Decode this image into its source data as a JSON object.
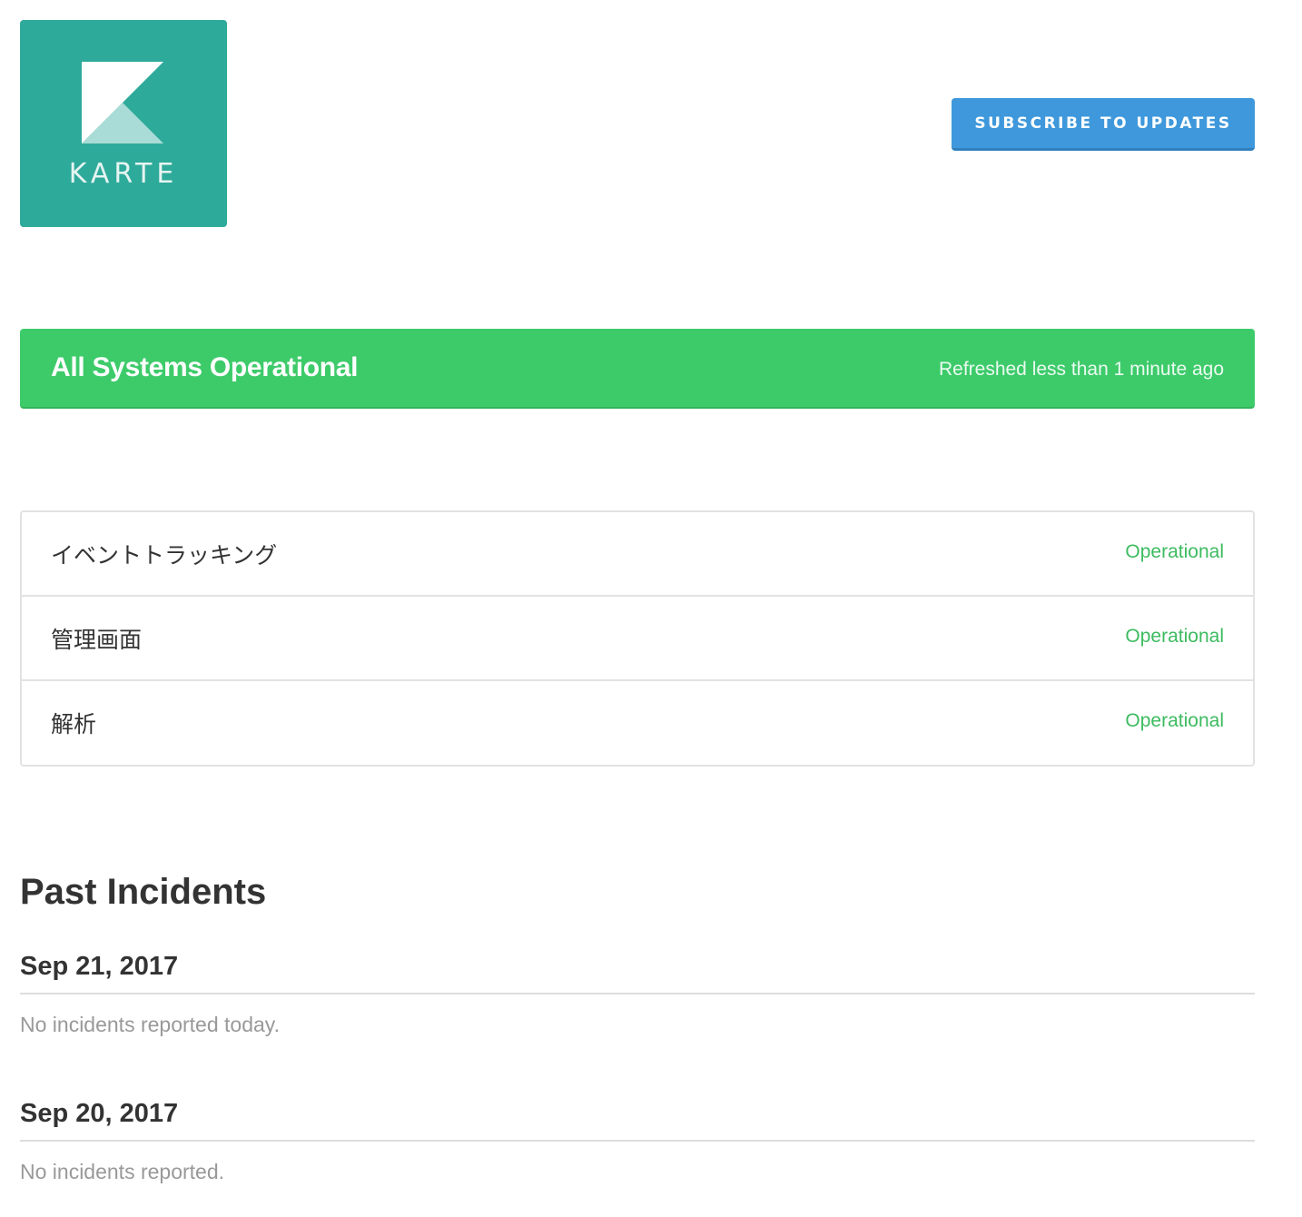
{
  "header": {
    "logo_text": "KARTE",
    "subscribe_label": "Subscribe to Updates"
  },
  "colors": {
    "logo_bg": "#2eaa9b",
    "subscribe_bg": "#3e98db",
    "status_green": "#3dcb6a",
    "operational_text": "#3dbb60"
  },
  "status": {
    "title": "All Systems Operational",
    "refreshed": "Refreshed less than 1 minute ago"
  },
  "components": [
    {
      "name": "イベントトラッキング",
      "status": "Operational"
    },
    {
      "name": "管理画面",
      "status": "Operational"
    },
    {
      "name": "解析",
      "status": "Operational"
    }
  ],
  "past_incidents": {
    "title": "Past Incidents",
    "days": [
      {
        "date": "Sep 21, 2017",
        "note": "No incidents reported today."
      },
      {
        "date": "Sep 20, 2017",
        "note": "No incidents reported."
      }
    ]
  }
}
